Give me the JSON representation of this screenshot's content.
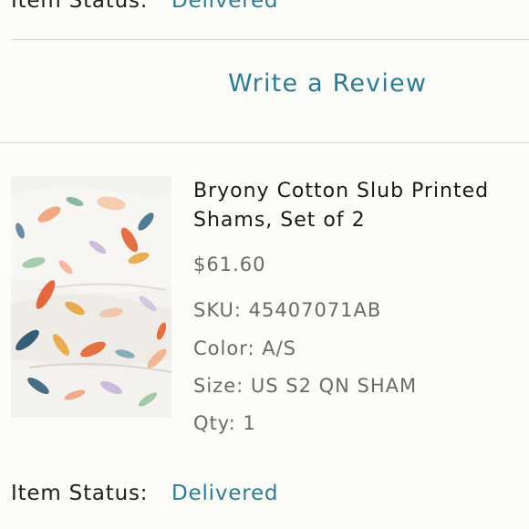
{
  "top_status": {
    "label": "Item Status:",
    "value": "Delivered"
  },
  "review": {
    "label": "Write a Review"
  },
  "product": {
    "title": "Bryony Cotton Slub Printed Shams, Set of 2",
    "price": "$61.60",
    "sku": "SKU: 45407071AB",
    "color": "Color: A/S",
    "size": "Size: US S2 QN SHAM",
    "qty": "Qty: 1"
  },
  "bottom_status": {
    "label": "Item Status:",
    "value": "Delivered"
  },
  "colors": {
    "accent": "#2a7d92",
    "text": "#1f1f1f",
    "muted": "#6a6a6a",
    "divider": "#d6d6d2",
    "background": "#fcfcf9"
  }
}
